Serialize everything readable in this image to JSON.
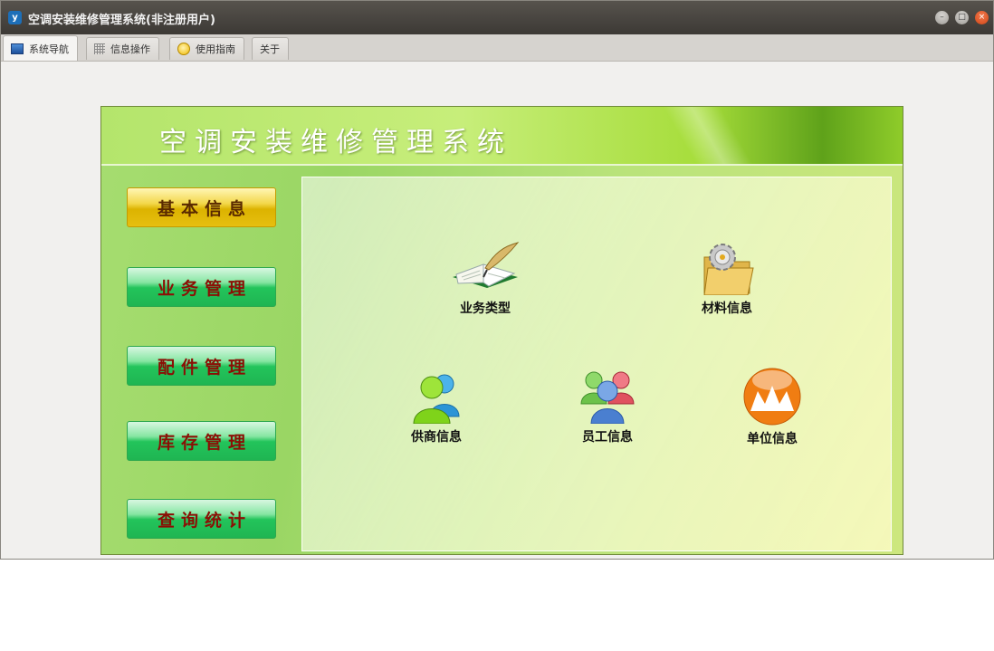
{
  "window": {
    "title": "空调安装维修管理系统(非注册用户)",
    "app_icon_letter": "y"
  },
  "tabs": [
    {
      "label": "系统导航",
      "icon": "monitor-icon",
      "active": true
    },
    {
      "label": "信息操作",
      "icon": "grid-icon",
      "active": false
    },
    {
      "label": "使用指南",
      "icon": "help-circle-icon",
      "active": false
    },
    {
      "label": "关于",
      "icon": "",
      "active": false
    }
  ],
  "banner": {
    "title": "空调安装维修管理系统"
  },
  "nav": [
    {
      "label": "基本信息",
      "selected": true
    },
    {
      "label": "业务管理",
      "selected": false
    },
    {
      "label": "配件管理",
      "selected": false
    },
    {
      "label": "库存管理",
      "selected": false
    },
    {
      "label": "查询统计",
      "selected": false
    }
  ],
  "items": [
    {
      "label": "业务类型",
      "icon": "book-quill-icon"
    },
    {
      "label": "材料信息",
      "icon": "gear-folder-icon"
    },
    {
      "label": "供商信息",
      "icon": "users-icon"
    },
    {
      "label": "员工信息",
      "icon": "team-icon"
    },
    {
      "label": "单位信息",
      "icon": "company-icon"
    }
  ],
  "colors": {
    "accent_green": "#23c45b",
    "selected_gold": "#dcb300",
    "nav_text": "#8a0f05"
  }
}
